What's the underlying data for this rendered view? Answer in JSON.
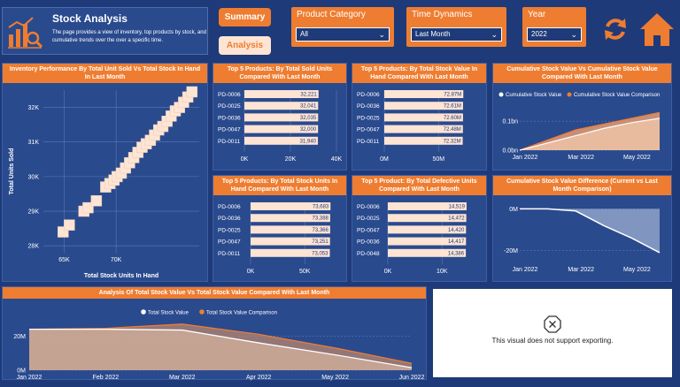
{
  "header": {
    "title": "Stock Analysis",
    "description": "The page provides a view of inventory, top products by stock, and cumulative trends over the over a specific time.",
    "summary_button": "Summary",
    "analysis_button": "Analysis",
    "product_category": {
      "label": "Product Category",
      "value": "All"
    },
    "time_dynamics": {
      "label": "Time Dynamics",
      "value": "Last Month"
    },
    "year": {
      "label": "Year",
      "value": "2022"
    }
  },
  "scatter": {
    "title": "Inventory Performance By Total Unit Sold Vs Total Stock In Hand In Last Month",
    "xlabel": "Total Stock Units In Hand",
    "ylabel": "Total Units Sold",
    "xticks": [
      "65K",
      "70K"
    ],
    "yticks": [
      "32K",
      "31K",
      "30K",
      "29K",
      "28K"
    ]
  },
  "sold": {
    "title": "Top 5 Products: By Total Sold Units Compared With Last Month",
    "ticks": [
      "0K",
      "20K",
      "40K"
    ]
  },
  "stockvalue": {
    "title": "Top 5 Products: By Total Stock Value In Hand Compared With Last Month",
    "ticks": [
      "0M",
      "50M"
    ]
  },
  "stockunits": {
    "title": "Top 5 Products: By Total Stock Units In Hand Compared With Last Month",
    "ticks": [
      "0K",
      "50K"
    ]
  },
  "defective": {
    "title": "Top 5 Product: By Total Defective Units Compared With Last Month",
    "ticks": [
      "0K",
      "10K"
    ]
  },
  "cumulative": {
    "title": "Cumulative Stock Value Vs Cumulative Stock Value Compared With Last Month",
    "legend": [
      "Cumulative Stock Value",
      "Cumulative Stock Value Comparison"
    ],
    "yticks": [
      "0.1bn",
      "0.0bn"
    ],
    "xticks": [
      "Jan 2022",
      "Mar 2022",
      "May 2022"
    ]
  },
  "difference": {
    "title": "Cumulative Stock Value Difference (Current vs Last Month Comparison)",
    "yticks": [
      "0M",
      "-20M"
    ],
    "xticks": [
      "Jan 2022",
      "Mar 2022",
      "May 2022"
    ]
  },
  "analysis": {
    "title": "Analysis Of Total Stock Value Vs Total Stock Value Compared With Last Month",
    "legend": [
      "Total Stock Value",
      "Total Stock Value Comparison"
    ],
    "yticks": [
      "20M",
      "0M"
    ],
    "xticks": [
      "Jan 2022",
      "Feb 2022",
      "Mar 2022",
      "Apr 2022",
      "May 2022",
      "Jun 2022"
    ]
  },
  "export_message": "This visual does not support exporting.",
  "icons": [
    "bar-chart-logo-icon",
    "refresh-icon",
    "home-icon",
    "chevron-down-icon",
    "warning-x-icon"
  ],
  "colors": {
    "background": "#1f3a78",
    "accent": "#ee7d31",
    "bar": "#fde4d3"
  },
  "chart_data": [
    {
      "type": "scatter",
      "title": "Inventory Performance By Total Unit Sold Vs Total Stock In Hand In Last Month",
      "xlabel": "Total Stock Units In Hand",
      "ylabel": "Total Units Sold",
      "points": [
        [
          64.9,
          28.4
        ],
        [
          65.5,
          28.6
        ],
        [
          66.9,
          29.0
        ],
        [
          67.3,
          29.1
        ],
        [
          68.1,
          29.3
        ],
        [
          69.0,
          29.7
        ],
        [
          69.4,
          29.8
        ],
        [
          69.8,
          29.9
        ],
        [
          70.1,
          30.0
        ],
        [
          70.5,
          30.1
        ],
        [
          70.9,
          30.25
        ],
        [
          71.3,
          30.4
        ],
        [
          71.7,
          30.55
        ],
        [
          72.1,
          30.7
        ],
        [
          72.5,
          30.85
        ],
        [
          72.9,
          30.95
        ],
        [
          73.3,
          31.05
        ],
        [
          73.7,
          31.2
        ],
        [
          74.1,
          31.35
        ],
        [
          74.5,
          31.45
        ],
        [
          74.9,
          31.6
        ],
        [
          75.3,
          31.75
        ],
        [
          75.7,
          31.9
        ],
        [
          76.1,
          32.0
        ],
        [
          76.5,
          32.15
        ],
        [
          76.9,
          32.3
        ],
        [
          77.3,
          32.45
        ]
      ],
      "xlim": [
        63,
        78
      ],
      "ylim": [
        27.8,
        32.5
      ]
    },
    {
      "type": "bar",
      "title": "Top 5 Products: By Total Sold Units Compared With Last Month",
      "categories": [
        "PD-0006",
        "PD-0025",
        "PD-0036",
        "PD-0047",
        "PD-0011"
      ],
      "values": [
        32221,
        32041,
        32035,
        32000,
        31940
      ],
      "value_labels": [
        "32,221",
        "32,041",
        "32,035",
        "32,000",
        "31,940"
      ],
      "xlim": [
        0,
        40000
      ]
    },
    {
      "type": "bar",
      "title": "Top 5 Products: By Total Stock Value In Hand Compared With Last Month",
      "categories": [
        "PD-0006",
        "PD-0036",
        "PD-0025",
        "PD-0047",
        "PD-0011"
      ],
      "values": [
        72.87,
        72.61,
        72.6,
        72.48,
        72.32
      ],
      "value_labels": [
        "72.87M",
        "72.61M",
        "72.60M",
        "72.48M",
        "72.32M"
      ],
      "xlim": [
        0,
        80
      ]
    },
    {
      "type": "bar",
      "title": "Top 5 Products: By Total Stock Units In Hand Compared With Last Month",
      "categories": [
        "PD-0006",
        "PD-0036",
        "PD-0025",
        "PD-0047",
        "PD-0011"
      ],
      "values": [
        73683,
        73388,
        73366,
        73251,
        73053
      ],
      "value_labels": [
        "73,683",
        "73,388",
        "73,366",
        "73,251",
        "73,053"
      ],
      "xlim": [
        0,
        80000
      ]
    },
    {
      "type": "bar",
      "title": "Top 5 Product: By Total Defective Units Compared With Last Month",
      "categories": [
        "PD-0006",
        "PD-0025",
        "PD-0047",
        "PD-0036",
        "PD-0048"
      ],
      "values": [
        14519,
        14472,
        14420,
        14417,
        14386
      ],
      "value_labels": [
        "14,519",
        "14,472",
        "14,420",
        "14,417",
        "14,386"
      ],
      "xlim": [
        0,
        16000
      ]
    },
    {
      "type": "area",
      "title": "Cumulative Stock Value Vs Cumulative Stock Value Compared With Last Month",
      "x": [
        "Jan 2022",
        "Feb 2022",
        "Mar 2022",
        "Apr 2022",
        "May 2022",
        "Jun 2022"
      ],
      "series": [
        {
          "name": "Cumulative Stock Value",
          "values": [
            0.0,
            0.025,
            0.05,
            0.075,
            0.095,
            0.11
          ]
        },
        {
          "name": "Cumulative Stock Value Comparison",
          "values": [
            0.0,
            0.035,
            0.07,
            0.09,
            0.11,
            0.13
          ]
        }
      ],
      "ylim": [
        0,
        0.14
      ]
    },
    {
      "type": "area",
      "title": "Cumulative Stock Value Difference (Current vs Last Month Comparison)",
      "x": [
        "Jan 2022",
        "Feb 2022",
        "Mar 2022",
        "Apr 2022",
        "May 2022",
        "Jun 2022"
      ],
      "series": [
        {
          "name": "Difference",
          "values": [
            0,
            0,
            -1,
            -8,
            -14,
            -21
          ]
        }
      ],
      "ylim": [
        -24,
        4
      ]
    },
    {
      "type": "area",
      "title": "Analysis Of Total Stock Value Vs Total Stock Value Compared With Last Month",
      "x": [
        "Jan 2022",
        "Feb 2022",
        "Mar 2022",
        "Apr 2022",
        "May 2022",
        "Jun 2022"
      ],
      "series": [
        {
          "name": "Total Stock Value",
          "values": [
            24,
            24,
            23.5,
            16,
            9,
            1.5
          ]
        },
        {
          "name": "Total Stock Value Comparison",
          "values": [
            24,
            24.5,
            27,
            21,
            13,
            4
          ]
        }
      ],
      "ylim": [
        0,
        30
      ]
    }
  ]
}
